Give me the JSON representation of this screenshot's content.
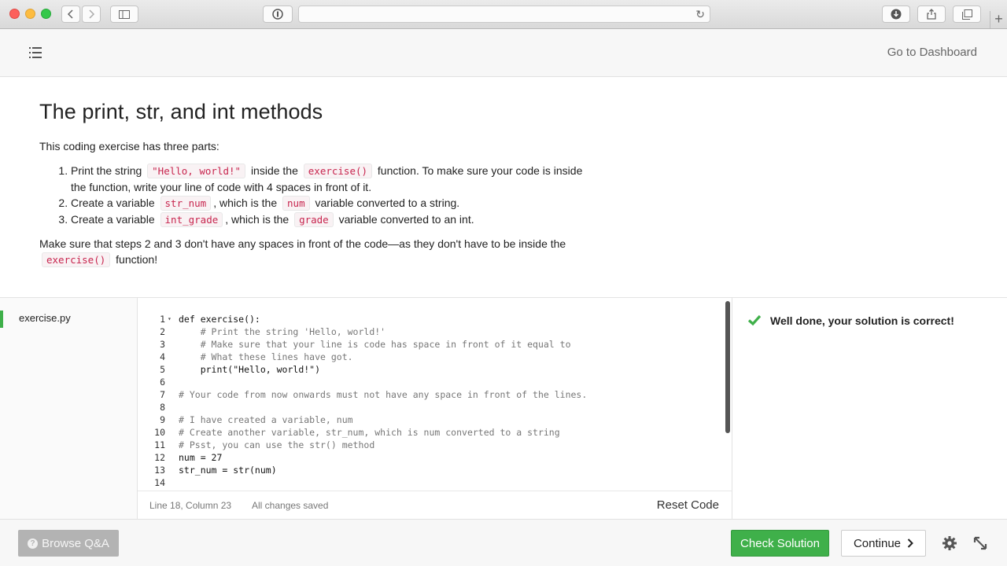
{
  "browser": {
    "reader_icon": "reader-mode-icon",
    "sidebar_icon": "sidebar-icon",
    "reload_icon": "reload-icon",
    "download_icon": "download-icon",
    "share_icon": "share-icon",
    "tabs_icon": "tabs-overview-icon"
  },
  "topbar": {
    "dashboard_link": "Go to Dashboard"
  },
  "lesson": {
    "title": "The print, str, and int methods",
    "intro": "This coding exercise has three parts:",
    "steps": [
      {
        "a": "Print the string",
        "code1": "\"Hello, world!\"",
        "b": "inside the",
        "code2": "exercise()",
        "c": "function. To make sure your code is inside the function, write your line of code with 4 spaces in front of it."
      },
      {
        "a": "Create a variable",
        "code1": "str_num",
        "b": ", which is the",
        "code2": "num",
        "c": "variable converted to a string."
      },
      {
        "a": "Create a variable",
        "code1": "int_grade",
        "b": ", which is the",
        "code2": "grade",
        "c": "variable converted to an int."
      }
    ],
    "note_a": "Make sure that steps 2 and 3 don't have any spaces in front of the code—as they don't have to be inside the",
    "note_code": "exercise()",
    "note_b": "function!"
  },
  "files": [
    {
      "name": "exercise.py"
    }
  ],
  "editor": {
    "lines": [
      {
        "n": "1",
        "text": "def exercise():"
      },
      {
        "n": "2",
        "text": "    # Print the string 'Hello, world!'"
      },
      {
        "n": "3",
        "text": "    # Make sure that your line is code has space in front of it equal to"
      },
      {
        "n": "4",
        "text": "    # What these lines have got."
      },
      {
        "n": "5",
        "text": "    print(\"Hello, world!\")"
      },
      {
        "n": "6",
        "text": ""
      },
      {
        "n": "7",
        "text": "# Your code from now onwards must not have any space in front of the lines."
      },
      {
        "n": "8",
        "text": ""
      },
      {
        "n": "9",
        "text": "# I have created a variable, num"
      },
      {
        "n": "10",
        "text": "# Create another variable, str_num, which is num converted to a string"
      },
      {
        "n": "11",
        "text": "# Psst, you can use the str() method"
      },
      {
        "n": "12",
        "text": "num = 27"
      },
      {
        "n": "13",
        "text": "str_num = str(num)"
      },
      {
        "n": "14",
        "text": ""
      }
    ],
    "cursor_position": "Line 18, Column 23",
    "save_status": "All changes saved",
    "reset_label": "Reset Code"
  },
  "result": {
    "message": "Well done, your solution is correct!",
    "color": "#3fb04a"
  },
  "bottom": {
    "qa_label": "Browse Q&A",
    "check_label": "Check Solution",
    "continue_label": "Continue"
  }
}
